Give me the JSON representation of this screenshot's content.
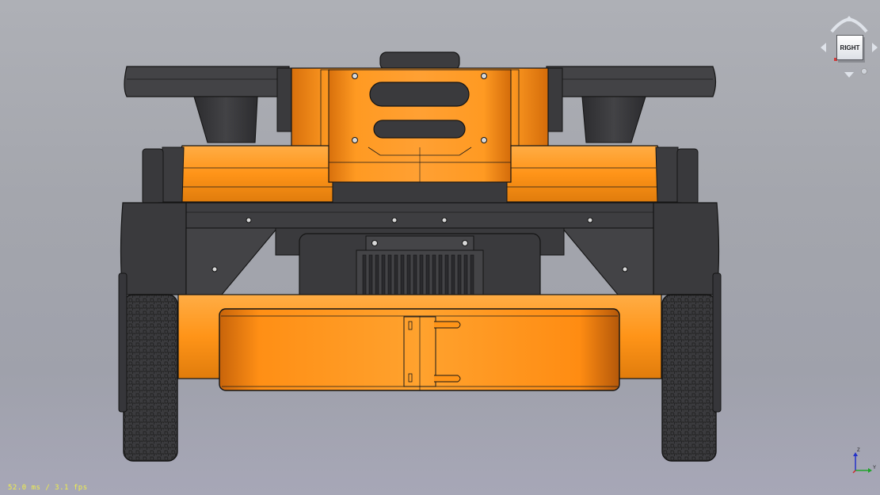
{
  "status": {
    "fps_text": "52.0 ms / 3.1 fps"
  },
  "navigation_cube": {
    "face_label": "RIGHT"
  },
  "axis_indicator": {
    "z_label": "Z",
    "y_label": "Y"
  },
  "colors": {
    "background_top": "#aeb0b6",
    "background_bottom": "#a7a7b7",
    "body_orange": "#ff9418",
    "body_dark": "#3a3a3d",
    "edge_black": "#141414",
    "fps_yellow": "#f0ef4a"
  }
}
